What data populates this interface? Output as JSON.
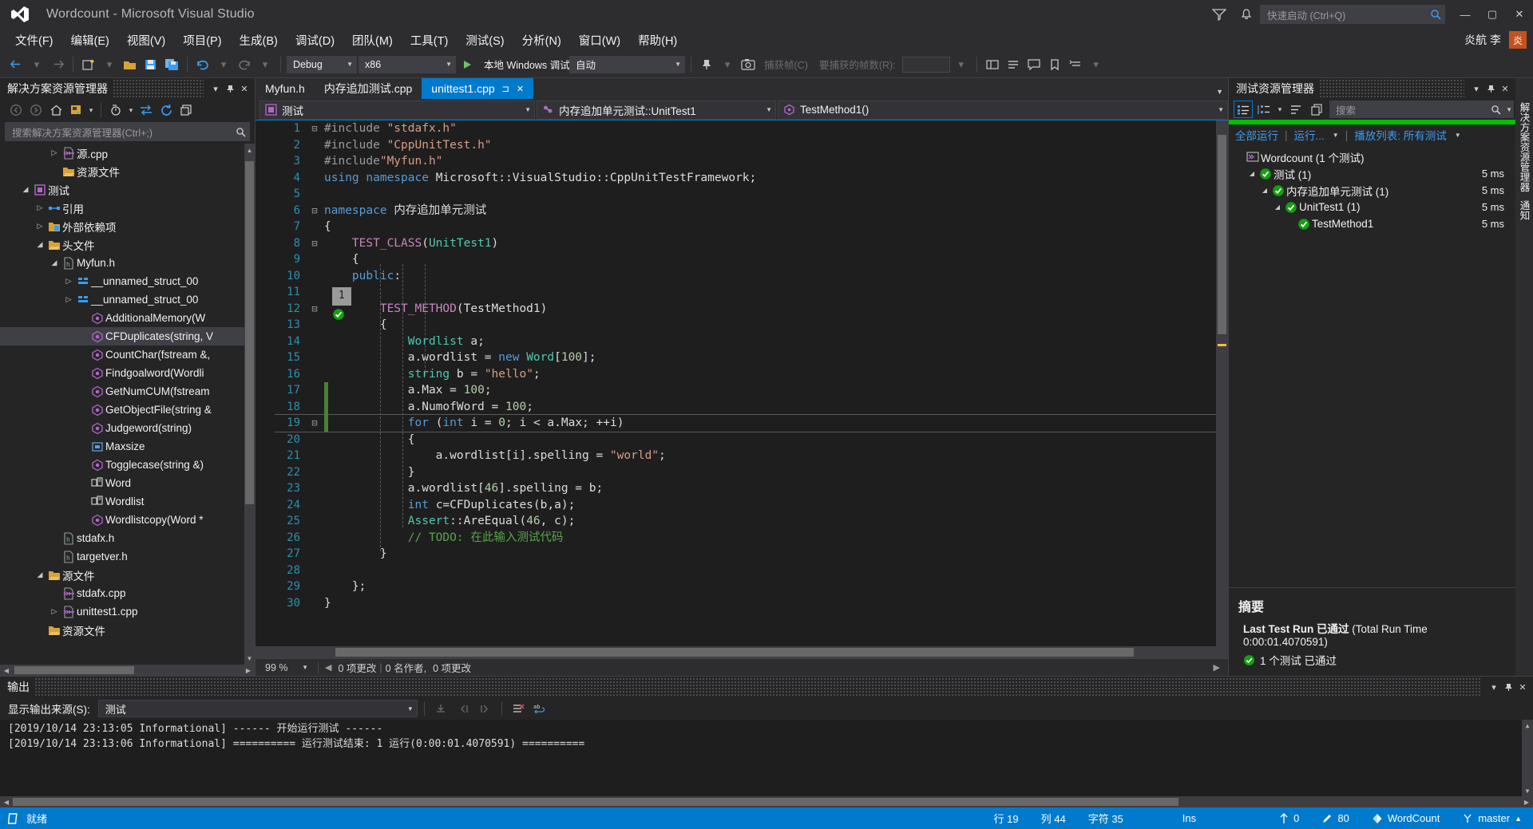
{
  "window": {
    "title": "Wordcount - Microsoft Visual Studio",
    "logo_icon": "visual-studio-logo",
    "feedback_icon": "feedback-icon",
    "quick_launch_placeholder": "快速启动 (Ctrl+Q)",
    "search_icon": "search-icon",
    "minimize_label": "—",
    "maximize_label": "▢",
    "close_label": "✕"
  },
  "menu": {
    "items": [
      {
        "label": "文件(F)"
      },
      {
        "label": "编辑(E)"
      },
      {
        "label": "视图(V)"
      },
      {
        "label": "项目(P)"
      },
      {
        "label": "生成(B)"
      },
      {
        "label": "调试(D)"
      },
      {
        "label": "团队(M)"
      },
      {
        "label": "工具(T)"
      },
      {
        "label": "测试(S)"
      },
      {
        "label": "分析(N)"
      },
      {
        "label": "窗口(W)"
      },
      {
        "label": "帮助(H)"
      }
    ],
    "user_name": "炎航 李",
    "user_initial": "炎"
  },
  "toolbar": {
    "config": "Debug",
    "platform": "x86",
    "debug_target": "本地 Windows 调试器",
    "auto": "自动",
    "capture_frame_label": "捕获帧(C)",
    "frames_label": "要捕获的帧数(R):",
    "frames_value": "",
    "icons": [
      "back-arrow-icon",
      "forward-arrow-icon",
      "new-project-icon",
      "open-file-icon",
      "save-icon",
      "save-all-icon",
      "undo-icon",
      "redo-icon",
      "start-debug-icon",
      "camera-icon",
      "performance-icon",
      "comment-icon",
      "bookmark-icon",
      "toggle-icon"
    ]
  },
  "solution_explorer": {
    "title": "解决方案资源管理器",
    "search_placeholder": "搜索解决方案资源管理器(Ctrl+;)",
    "toolbar_icons": [
      "back-icon",
      "forward-icon",
      "home-icon",
      "sync-icon",
      "pending-changes-icon",
      "refresh-icon",
      "collapse-all-icon",
      "properties-icon"
    ],
    "tree": [
      {
        "indent": 3,
        "twisty": "▷",
        "icon": "cpp-file-icon",
        "label": "源.cpp",
        "selected": false
      },
      {
        "indent": 3,
        "twisty": "",
        "icon": "folder-icon",
        "label": "资源文件",
        "selected": false
      },
      {
        "indent": 1,
        "twisty": "◢",
        "icon": "project-icon",
        "label": "测试",
        "selected": false
      },
      {
        "indent": 2,
        "twisty": "▷",
        "icon": "references-icon",
        "label": "引用",
        "selected": false
      },
      {
        "indent": 2,
        "twisty": "▷",
        "icon": "external-deps-icon",
        "label": "外部依赖项",
        "selected": false
      },
      {
        "indent": 2,
        "twisty": "◢",
        "icon": "folder-icon",
        "label": "头文件",
        "selected": false
      },
      {
        "indent": 3,
        "twisty": "◢",
        "icon": "header-file-icon",
        "label": "Myfun.h",
        "selected": false
      },
      {
        "indent": 4,
        "twisty": "▷",
        "icon": "struct-icon",
        "label": "__unnamed_struct_00",
        "selected": false
      },
      {
        "indent": 4,
        "twisty": "▷",
        "icon": "struct-icon",
        "label": "__unnamed_struct_00",
        "selected": false
      },
      {
        "indent": 5,
        "twisty": "",
        "icon": "method-icon",
        "label": "AdditionalMemory(W",
        "selected": false
      },
      {
        "indent": 5,
        "twisty": "",
        "icon": "method-icon",
        "label": "CFDuplicates(string, V",
        "selected": true
      },
      {
        "indent": 5,
        "twisty": "",
        "icon": "method-icon",
        "label": "CountChar(fstream &,",
        "selected": false
      },
      {
        "indent": 5,
        "twisty": "",
        "icon": "method-icon",
        "label": "Findgoalword(Wordli",
        "selected": false
      },
      {
        "indent": 5,
        "twisty": "",
        "icon": "method-icon",
        "label": "GetNumCUM(fstream",
        "selected": false
      },
      {
        "indent": 5,
        "twisty": "",
        "icon": "method-icon",
        "label": "GetObjectFile(string &",
        "selected": false
      },
      {
        "indent": 5,
        "twisty": "",
        "icon": "method-icon",
        "label": "Judgeword(string)",
        "selected": false
      },
      {
        "indent": 5,
        "twisty": "",
        "icon": "macro-icon",
        "label": "Maxsize",
        "selected": false
      },
      {
        "indent": 5,
        "twisty": "",
        "icon": "method-icon",
        "label": "Togglecase(string &)",
        "selected": false
      },
      {
        "indent": 5,
        "twisty": "",
        "icon": "struct2-icon",
        "label": "Word",
        "selected": false
      },
      {
        "indent": 5,
        "twisty": "",
        "icon": "struct2-icon",
        "label": "Wordlist",
        "selected": false
      },
      {
        "indent": 5,
        "twisty": "",
        "icon": "method-icon",
        "label": "Wordlistcopy(Word *",
        "selected": false
      },
      {
        "indent": 3,
        "twisty": "",
        "icon": "header-file-icon",
        "label": "stdafx.h",
        "selected": false
      },
      {
        "indent": 3,
        "twisty": "",
        "icon": "header-file-icon",
        "label": "targetver.h",
        "selected": false
      },
      {
        "indent": 2,
        "twisty": "◢",
        "icon": "folder-icon",
        "label": "源文件",
        "selected": false
      },
      {
        "indent": 3,
        "twisty": "",
        "icon": "cpp-file-icon",
        "label": "stdafx.cpp",
        "selected": false
      },
      {
        "indent": 3,
        "twisty": "▷",
        "icon": "cpp-file-icon",
        "label": "unittest1.cpp",
        "selected": false
      },
      {
        "indent": 2,
        "twisty": "",
        "icon": "folder-icon",
        "label": "资源文件",
        "selected": false
      }
    ]
  },
  "editor": {
    "tabs": [
      {
        "label": "Myfun.h",
        "active": false,
        "closable": false
      },
      {
        "label": "内存追加测试.cpp",
        "active": false,
        "closable": false
      },
      {
        "label": "unittest1.cpp",
        "active": true,
        "closable": true,
        "pin": "⊐",
        "close": "✕"
      }
    ],
    "nav": {
      "project": "测试",
      "scope": "内存追加单元测试::UnitTest1",
      "member": "TestMethod1()"
    },
    "codelens": "1",
    "lines": [
      {
        "n": "1",
        "fold": "⊟",
        "tokens": [
          {
            "t": "#include ",
            "c": "pp"
          },
          {
            "t": "\"stdafx.h\"",
            "c": "str"
          }
        ]
      },
      {
        "n": "2",
        "fold": "",
        "tokens": [
          {
            "t": "#include ",
            "c": "pp"
          },
          {
            "t": "\"CppUnitTest.h\"",
            "c": "str"
          }
        ]
      },
      {
        "n": "3",
        "fold": "",
        "tokens": [
          {
            "t": "#include",
            "c": "pp"
          },
          {
            "t": "\"Myfun.h\"",
            "c": "str"
          }
        ]
      },
      {
        "n": "4",
        "fold": "",
        "tokens": [
          {
            "t": "using namespace ",
            "c": "kw"
          },
          {
            "t": "Microsoft::VisualStudio::CppUnitTestFramework;",
            "c": "plain"
          }
        ]
      },
      {
        "n": "5",
        "fold": "",
        "tokens": []
      },
      {
        "n": "6",
        "fold": "⊟",
        "tokens": [
          {
            "t": "namespace ",
            "c": "kw"
          },
          {
            "t": "内存追加单元测试",
            "c": "plain"
          }
        ]
      },
      {
        "n": "7",
        "fold": "",
        "tokens": [
          {
            "t": "{",
            "c": "plain"
          }
        ]
      },
      {
        "n": "8",
        "fold": "⊟",
        "tokens": [
          {
            "t": "    TEST_CLASS",
            "c": "macro"
          },
          {
            "t": "(",
            "c": "plain"
          },
          {
            "t": "UnitTest1",
            "c": "type"
          },
          {
            "t": ")",
            "c": "plain"
          }
        ]
      },
      {
        "n": "9",
        "fold": "",
        "tokens": [
          {
            "t": "    {",
            "c": "plain"
          }
        ]
      },
      {
        "n": "10",
        "fold": "",
        "tokens": [
          {
            "t": "    public",
            "c": "kw"
          },
          {
            "t": ":",
            "c": "plain"
          }
        ]
      },
      {
        "n": "11",
        "fold": "",
        "tokens": []
      },
      {
        "n": "12",
        "fold": "⊟",
        "tokens": [
          {
            "t": "        TEST_METHOD",
            "c": "macro"
          },
          {
            "t": "(TestMethod1)",
            "c": "plain"
          }
        ]
      },
      {
        "n": "13",
        "fold": "",
        "tokens": [
          {
            "t": "        {",
            "c": "plain"
          }
        ]
      },
      {
        "n": "14",
        "fold": "",
        "tokens": [
          {
            "t": "            ",
            "c": "plain"
          },
          {
            "t": "Wordlist",
            "c": "type"
          },
          {
            "t": " a;",
            "c": "plain"
          }
        ]
      },
      {
        "n": "15",
        "fold": "",
        "tokens": [
          {
            "t": "            a.wordlist = ",
            "c": "plain"
          },
          {
            "t": "new",
            "c": "kw"
          },
          {
            "t": " ",
            "c": "plain"
          },
          {
            "t": "Word",
            "c": "type"
          },
          {
            "t": "[",
            "c": "plain"
          },
          {
            "t": "100",
            "c": "num"
          },
          {
            "t": "];",
            "c": "plain"
          }
        ]
      },
      {
        "n": "16",
        "fold": "",
        "tokens": [
          {
            "t": "            ",
            "c": "plain"
          },
          {
            "t": "string",
            "c": "type"
          },
          {
            "t": " b = ",
            "c": "plain"
          },
          {
            "t": "\"hello\"",
            "c": "str"
          },
          {
            "t": ";",
            "c": "plain"
          }
        ]
      },
      {
        "n": "17",
        "fold": "",
        "tokens": [
          {
            "t": "            a.Max = ",
            "c": "plain"
          },
          {
            "t": "100",
            "c": "num"
          },
          {
            "t": ";",
            "c": "plain"
          }
        ]
      },
      {
        "n": "18",
        "fold": "",
        "tokens": [
          {
            "t": "            a.NumofWord = ",
            "c": "plain"
          },
          {
            "t": "100",
            "c": "num"
          },
          {
            "t": ";",
            "c": "plain"
          }
        ]
      },
      {
        "n": "19",
        "fold": "⊟",
        "tokens": [
          {
            "t": "            ",
            "c": "plain"
          },
          {
            "t": "for",
            "c": "kw"
          },
          {
            "t": " (",
            "c": "plain"
          },
          {
            "t": "int",
            "c": "kw"
          },
          {
            "t": " i = ",
            "c": "plain"
          },
          {
            "t": "0",
            "c": "num"
          },
          {
            "t": "; i < a.Max; ++i)",
            "c": "plain"
          }
        ]
      },
      {
        "n": "20",
        "fold": "",
        "tokens": [
          {
            "t": "            {",
            "c": "plain"
          }
        ]
      },
      {
        "n": "21",
        "fold": "",
        "tokens": [
          {
            "t": "                a.wordlist[i].spelling = ",
            "c": "plain"
          },
          {
            "t": "\"world\"",
            "c": "str"
          },
          {
            "t": ";",
            "c": "plain"
          }
        ]
      },
      {
        "n": "22",
        "fold": "",
        "tokens": [
          {
            "t": "            }",
            "c": "plain"
          }
        ]
      },
      {
        "n": "23",
        "fold": "",
        "tokens": [
          {
            "t": "            a.wordlist[",
            "c": "plain"
          },
          {
            "t": "46",
            "c": "num"
          },
          {
            "t": "].spelling = b;",
            "c": "plain"
          }
        ]
      },
      {
        "n": "24",
        "fold": "",
        "tokens": [
          {
            "t": "            ",
            "c": "plain"
          },
          {
            "t": "int",
            "c": "kw"
          },
          {
            "t": " c=CFDuplicates(b,a);",
            "c": "plain"
          }
        ]
      },
      {
        "n": "25",
        "fold": "",
        "tokens": [
          {
            "t": "            ",
            "c": "plain"
          },
          {
            "t": "Assert",
            "c": "type"
          },
          {
            "t": "::AreEqual(",
            "c": "plain"
          },
          {
            "t": "46",
            "c": "num"
          },
          {
            "t": ", c);",
            "c": "plain"
          }
        ]
      },
      {
        "n": "26",
        "fold": "",
        "tokens": [
          {
            "t": "            // TODO: 在此输入测试代码",
            "c": "cmt"
          }
        ]
      },
      {
        "n": "27",
        "fold": "",
        "tokens": [
          {
            "t": "        }",
            "c": "plain"
          }
        ]
      },
      {
        "n": "28",
        "fold": "",
        "tokens": []
      },
      {
        "n": "29",
        "fold": "",
        "tokens": [
          {
            "t": "    };",
            "c": "plain"
          }
        ]
      },
      {
        "n": "30",
        "fold": "",
        "tokens": [
          {
            "t": "}",
            "c": "plain"
          }
        ]
      }
    ],
    "status": {
      "zoom": "99 %",
      "changes_left": "0 项更改",
      "authors": "0 名作者,",
      "changes_right": "0 项更改"
    }
  },
  "test_explorer": {
    "title": "测试资源管理器",
    "search_placeholder": "搜索",
    "toolbar_icons": [
      "list-view-icon",
      "group-by-icon",
      "sort-icon",
      "copy-icon"
    ],
    "actions": {
      "run_all": "全部运行",
      "run": "运行...",
      "playlist": "播放列表: 所有测试"
    },
    "tree": [
      {
        "indent": 0,
        "twisty": "",
        "icon": "solution-icon",
        "label": "Wordcount (1 个测试)",
        "duration": ""
      },
      {
        "indent": 1,
        "twisty": "◢",
        "icon": "pass-icon",
        "label": "测试 (1)",
        "duration": "5 ms"
      },
      {
        "indent": 2,
        "twisty": "◢",
        "icon": "pass-icon",
        "label": "内存追加单元测试 (1)",
        "duration": "5 ms"
      },
      {
        "indent": 3,
        "twisty": "◢",
        "icon": "pass-icon",
        "label": "UnitTest1 (1)",
        "duration": "5 ms"
      },
      {
        "indent": 4,
        "twisty": "",
        "icon": "pass-icon",
        "label": "TestMethod1",
        "duration": "5 ms"
      }
    ],
    "detail": {
      "heading": "摘要",
      "last_run_bold": "Last Test Run 已通过",
      "last_run_rest": " (Total Run Time 0:00:01.4070591)",
      "passed_text": "1 个测试 已通过"
    },
    "vertical_tabs": [
      "解决方案资源管理器",
      "通知"
    ]
  },
  "output": {
    "title": "输出",
    "source_label": "显示输出来源(S):",
    "source_value": "测试",
    "toolbar_icons": [
      "clear-output-icon",
      "prev-icon",
      "next-icon",
      "clear-all-icon",
      "wordwrap-icon"
    ],
    "lines": [
      "[2019/10/14 23:13:05 Informational] ------ 开始运行测试 ------",
      "[2019/10/14 23:13:06 Informational] ========== 运行测试结束: 1 运行(0:00:01.4070591) =========="
    ]
  },
  "statusbar": {
    "ready": "就绪",
    "line": "行 19",
    "col": "列 44",
    "chars": "字符 35",
    "ins": "Ins",
    "up_count": "0",
    "pencil_count": "80",
    "repo": "WordCount",
    "branch": "master"
  }
}
